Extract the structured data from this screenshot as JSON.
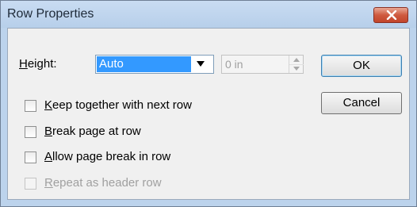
{
  "window": {
    "title": "Row Properties"
  },
  "height": {
    "label_accel": "H",
    "label_rest": "eight:",
    "select_value": "Auto",
    "spin_value": "0 in"
  },
  "buttons": {
    "ok": "OK",
    "cancel": "Cancel"
  },
  "options": [
    {
      "accel": "K",
      "rest": "eep together with next row",
      "checked": false,
      "enabled": true
    },
    {
      "accel": "B",
      "rest": "reak page at row",
      "checked": false,
      "enabled": true
    },
    {
      "accel": "A",
      "rest": "llow page break in row",
      "checked": false,
      "enabled": true
    },
    {
      "accel": "R",
      "rest": "epeat as header row",
      "checked": false,
      "enabled": false
    }
  ],
  "icons": {
    "close": "close-icon",
    "dropdown": "chevron-down-icon",
    "spin_up": "triangle-up-icon",
    "spin_down": "triangle-down-icon"
  },
  "colors": {
    "selection": "#3399ff",
    "close": "#c2452b"
  }
}
